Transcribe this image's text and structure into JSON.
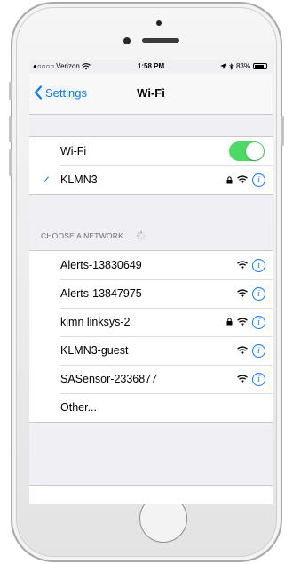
{
  "status_bar": {
    "carrier": "Verizon",
    "time": "1:58 PM",
    "battery": "83%",
    "battery_level": 0.83,
    "icons": [
      "signal-dots-icon",
      "wifi-icon",
      "location-arrow-icon",
      "bluetooth-icon",
      "battery-icon"
    ]
  },
  "nav": {
    "back_label": "Settings",
    "title": "Wi-Fi"
  },
  "wifi": {
    "label": "Wi-Fi",
    "enabled": true,
    "connected_network": "KLMN3"
  },
  "section_header": "CHOOSE A NETWORK...",
  "networks": [
    {
      "name": "Alerts-13830649",
      "secured": false
    },
    {
      "name": "Alerts-13847975",
      "secured": false
    },
    {
      "name": "klmn linksys-2",
      "secured": true
    },
    {
      "name": "KLMN3-guest",
      "secured": false
    },
    {
      "name": "SASensor-2336877",
      "secured": false
    }
  ],
  "other_label": "Other...",
  "colors": {
    "accent": "#007aff",
    "toggle_on": "#4cd964",
    "background": "#efeff4"
  }
}
